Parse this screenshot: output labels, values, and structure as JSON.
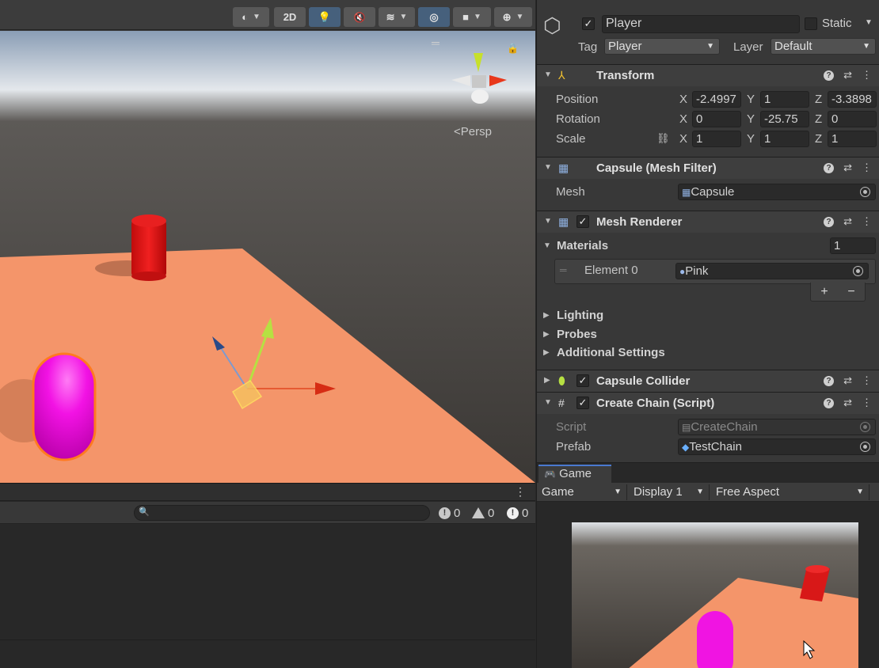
{
  "scene_view": {
    "toolbar": {
      "mode_2d_label": "2D"
    },
    "persp_label": "Persp"
  },
  "console": {
    "counts": {
      "info": "0",
      "warnings": "0",
      "errors": "0"
    }
  },
  "inspector": {
    "object_name": "Player",
    "static_label": "Static",
    "tag_label": "Tag",
    "tag_value": "Player",
    "layer_label": "Layer",
    "layer_value": "Default",
    "transform": {
      "title": "Transform",
      "position_label": "Position",
      "rotation_label": "Rotation",
      "scale_label": "Scale",
      "position": {
        "x": "-2.4997",
        "y": "1",
        "z": "-3.3898"
      },
      "rotation": {
        "x": "0",
        "y": "-25.75",
        "z": "0"
      },
      "scale": {
        "x": "1",
        "y": "1",
        "z": "1"
      }
    },
    "mesh_filter": {
      "title": "Capsule (Mesh Filter)",
      "mesh_label": "Mesh",
      "mesh_value": "Capsule"
    },
    "mesh_renderer": {
      "title": "Mesh Renderer",
      "materials_label": "Materials",
      "materials_count": "1",
      "element_label": "Element 0",
      "element_value": "Pink",
      "lighting_label": "Lighting",
      "probes_label": "Probes",
      "additional_label": "Additional Settings"
    },
    "capsule_collider": {
      "title": "Capsule Collider"
    },
    "create_chain": {
      "title": "Create Chain (Script)",
      "script_label": "Script",
      "script_value": "CreateChain",
      "prefab_label": "Prefab",
      "prefab_value": "TestChain"
    },
    "axes": {
      "x": "X",
      "y": "Y",
      "z": "Z"
    }
  },
  "game_view": {
    "tab_label": "Game",
    "mode_dropdown": "Game",
    "display_dropdown": "Display 1",
    "aspect_dropdown": "Free Aspect"
  },
  "colors": {
    "ground": "#F4956A",
    "capsule_pink": "#F010E0",
    "cylinder_red": "#E01818",
    "accent_blue": "#4A79D0"
  }
}
